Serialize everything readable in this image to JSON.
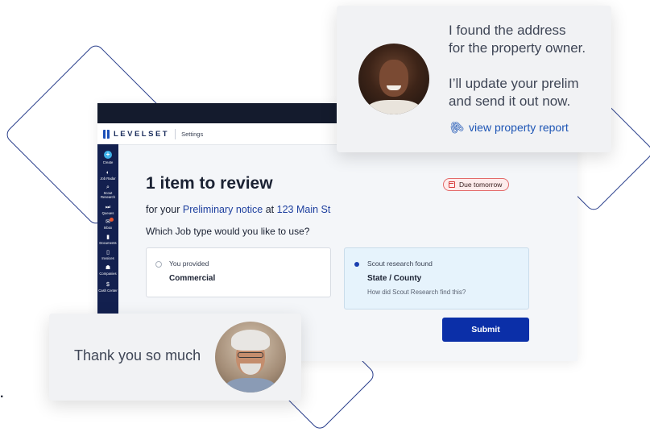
{
  "app": {
    "brand": "LEVELSET",
    "header_section": "Settings",
    "sidebar": {
      "items": [
        {
          "label": "Create",
          "icon": "plus-icon",
          "glyph": "+"
        },
        {
          "label": "Job Radar",
          "icon": "radar-icon",
          "glyph": "◐"
        },
        {
          "label": "Scout Research",
          "icon": "search-icon",
          "glyph": "⌕"
        },
        {
          "label": "Queues",
          "icon": "queue-icon",
          "glyph": "⏭"
        },
        {
          "label": "Inbox",
          "icon": "inbox-icon",
          "glyph": "✉"
        },
        {
          "label": "Documents",
          "icon": "document-icon",
          "glyph": "▮"
        },
        {
          "label": "Invoices",
          "icon": "invoice-icon",
          "glyph": "▯"
        },
        {
          "label": "Companies",
          "icon": "companies-icon",
          "glyph": "☗"
        },
        {
          "label": "Cash Center",
          "icon": "dollar-icon",
          "glyph": "$"
        }
      ]
    },
    "review": {
      "title": "1 item to review",
      "due_label": "Due tomorrow",
      "subtitle_prefix": "for your",
      "document_link": "Preliminary notice",
      "subtitle_mid": "at",
      "address_link": "123 Main St",
      "question": "Which Job type would you like to use?",
      "option_provided": {
        "label": "You provided",
        "value": "Commercial",
        "selected": false
      },
      "option_scout": {
        "label": "Scout research found",
        "value": "State / County",
        "link": "How did Scout Research find this?",
        "selected": true
      },
      "submit_label": "Submit"
    }
  },
  "chat_top": {
    "line1": "I found the address",
    "line2": "for the property owner.",
    "line3": "I’ll update your prelim",
    "line4": "and send it out now.",
    "link": "view property report"
  },
  "chat_bottom": {
    "text": "Thank you so much"
  },
  "stray_text": ".",
  "colors": {
    "primary_button": "#0b2fa8",
    "sidebar": "#13204f",
    "link": "#1d55b5",
    "due_border": "#e36a6a",
    "selected_card_bg": "#e6f3fc"
  }
}
